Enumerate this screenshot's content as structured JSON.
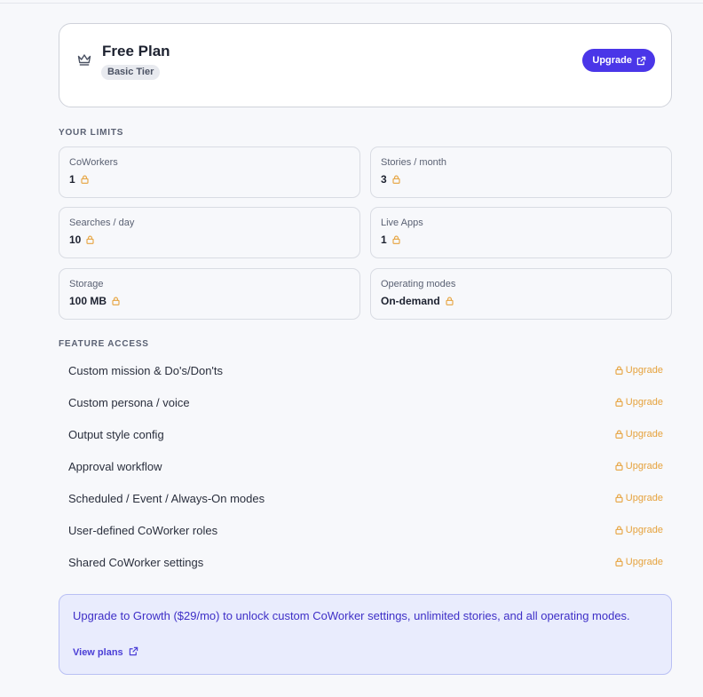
{
  "plan": {
    "title": "Free Plan",
    "tier": "Basic Tier",
    "upgrade_label": "Upgrade",
    "crown_icon": "crown-icon"
  },
  "limits": {
    "section_label": "YOUR LIMITS",
    "items": [
      {
        "name": "CoWorkers",
        "value": "1"
      },
      {
        "name": "Stories / month",
        "value": "3"
      },
      {
        "name": "Searches / day",
        "value": "10"
      },
      {
        "name": "Live Apps",
        "value": "1"
      },
      {
        "name": "Storage",
        "value": "100 MB"
      },
      {
        "name": "Operating modes",
        "value": "On-demand"
      }
    ]
  },
  "features": {
    "section_label": "FEATURE ACCESS",
    "items": [
      {
        "name": "Custom mission & Do's/Don'ts",
        "action": "Upgrade"
      },
      {
        "name": "Custom persona / voice",
        "action": "Upgrade"
      },
      {
        "name": "Output style config",
        "action": "Upgrade"
      },
      {
        "name": "Approval workflow",
        "action": "Upgrade"
      },
      {
        "name": "Scheduled / Event / Always-On modes",
        "action": "Upgrade"
      },
      {
        "name": "User-defined CoWorker roles",
        "action": "Upgrade"
      },
      {
        "name": "Shared CoWorker settings",
        "action": "Upgrade"
      }
    ]
  },
  "promo": {
    "text": "Upgrade to Growth ($29/mo) to unlock custom CoWorker settings, unlimited stories, and all operating modes.",
    "link_label": "View plans"
  },
  "colors": {
    "accent": "#4a36e8",
    "lock": "#e6a23c",
    "promo_bg": "#e9ecfd"
  }
}
